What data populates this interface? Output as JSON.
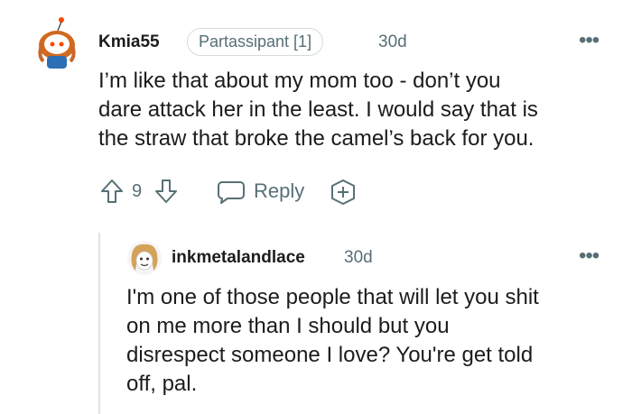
{
  "comment": {
    "username": "Kmia55",
    "flair": "Partassipant [1]",
    "timestamp": "30d",
    "body_lines": [
      "I’m like that about my mom too - don’t you",
      "dare attack her in the least. I would say that is",
      "the straw that broke the camel’s back for you."
    ],
    "vote_count": "9",
    "reply_label": "Reply",
    "icons": [
      "upvote-icon",
      "downvote-icon",
      "reply-icon",
      "award-icon",
      "more-options-icon"
    ]
  },
  "reply": {
    "username": "inkmetalandlace",
    "timestamp": "30d",
    "body_lines": [
      "I'm one of those people that will let you shit",
      "on me more than I should but you",
      "disrespect someone I love? You're get told",
      "off, pal."
    ]
  }
}
